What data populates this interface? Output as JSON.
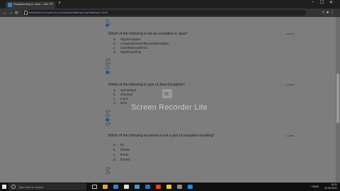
{
  "browser": {
    "tab_title": "Programming in Java – Unit 7",
    "new_tab": "+",
    "url": "arithmeticone.myeol.ac.in/mod/quiz/attempt.php?attempt=1234",
    "back": "←",
    "forward": "→",
    "reload": "⟳",
    "toolbar_icons": "☆  ●  ⋮",
    "min": "–",
    "max": "☐",
    "close": "✕"
  },
  "prev_question": {
    "radio_b": "b"
  },
  "questions": [
    {
      "text": "Which of the following is not an exception in Java?",
      "points": "1 point",
      "options": [
        {
          "letter": "a.",
          "text": "SQLException"
        },
        {
          "letter": "b.",
          "text": "ArrayIndexOutOfBoundsException"
        },
        {
          "letter": "c.",
          "text": "OutOfMemoryError"
        },
        {
          "letter": "d.",
          "text": "StackOverflow"
        }
      ],
      "answer_labels": [
        "a",
        "b",
        "c",
        "d"
      ],
      "selected": "d"
    },
    {
      "text": "Which of the following is type of Java Exception?",
      "points": "1 point",
      "options": [
        {
          "letter": "a.",
          "text": "unchecked"
        },
        {
          "letter": "b.",
          "text": "checked"
        },
        {
          "letter": "c.",
          "text": "a & b"
        },
        {
          "letter": "d.",
          "text": "error"
        }
      ],
      "answer_labels": [
        "a",
        "b",
        "c",
        "d"
      ],
      "selected": "c"
    },
    {
      "text": "Which of the following keywords is not a part of exception handling?",
      "points": "1 point",
      "options": [
        {
          "letter": "a.",
          "text": "try"
        },
        {
          "letter": "b.",
          "text": "throws"
        },
        {
          "letter": "c.",
          "text": "throw"
        },
        {
          "letter": "d.",
          "text": "thrown"
        }
      ],
      "answer_labels": [
        "a",
        "b"
      ],
      "selected": ""
    }
  ],
  "watermark": "Screen Recorder Lite",
  "taskbar": {
    "search_placeholder": "Type here to search",
    "time": "10:21",
    "date": "21-09-2021",
    "tray": "^  ENG"
  },
  "colors": {
    "selected_radio": "#2a4f9e",
    "page_dimmed": "#7d7d7d"
  }
}
